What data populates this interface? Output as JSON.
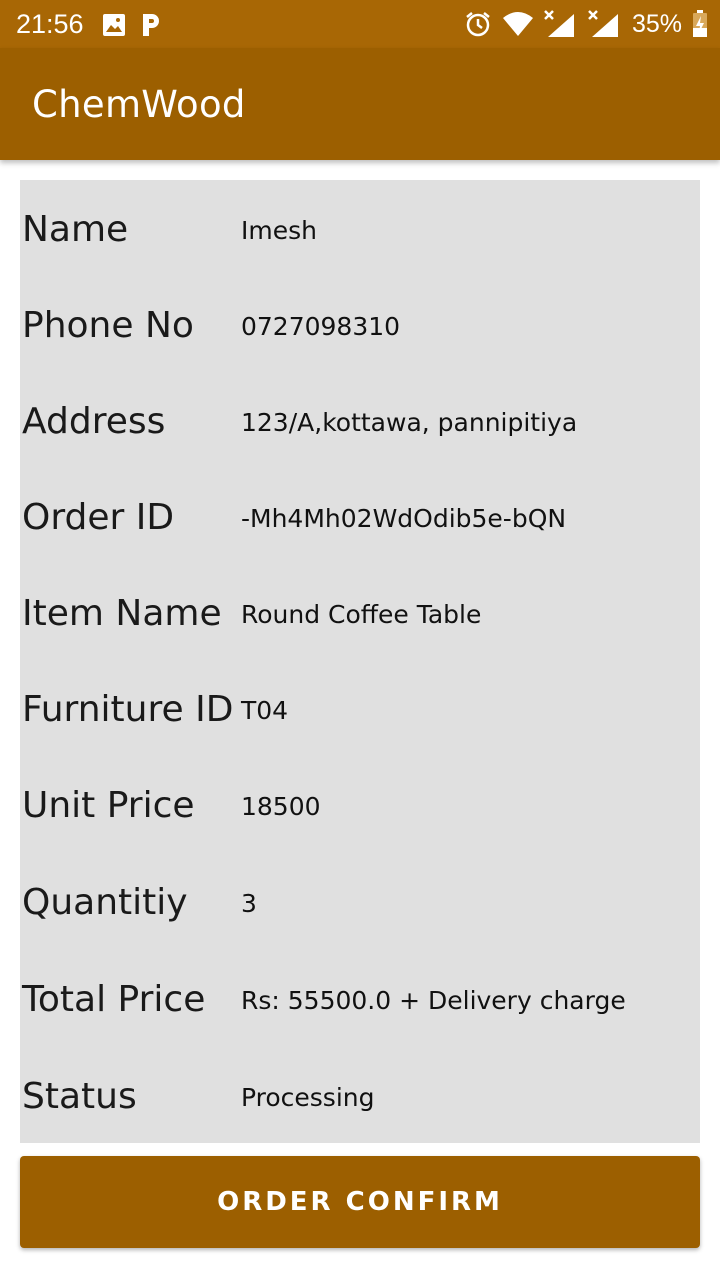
{
  "status_bar": {
    "time": "21:56",
    "battery": "35%",
    "icons": [
      "image-icon",
      "parking-icon",
      "alarm-icon",
      "wifi-icon",
      "signal-icon",
      "signal-icon",
      "battery-charging-icon"
    ]
  },
  "app": {
    "title": "ChemWood"
  },
  "details": [
    {
      "label": "Name",
      "value": "Imesh"
    },
    {
      "label": "Phone No",
      "value": "0727098310"
    },
    {
      "label": "Address",
      "value": "123/A,kottawa, pannipitiya"
    },
    {
      "label": "Order ID",
      "value": "-Mh4Mh02WdOdib5e-bQN"
    },
    {
      "label": "Item Name",
      "value": "Round Coffee Table"
    },
    {
      "label": "Furniture ID",
      "value": "T04"
    },
    {
      "label": "Unit Price",
      "value": "18500"
    },
    {
      "label": "Quantitiy",
      "value": "3"
    },
    {
      "label": "Total Price",
      "value": "Rs: 55500.0 + Delivery charge"
    },
    {
      "label": "Status",
      "value": "Processing"
    }
  ],
  "actions": {
    "confirm_label": "ORDER CONFIRM"
  },
  "colors": {
    "status_bar": "#a86705",
    "app_bar": "#9c5f00",
    "card": "#e0e0e0",
    "button": "#9c5f00"
  }
}
